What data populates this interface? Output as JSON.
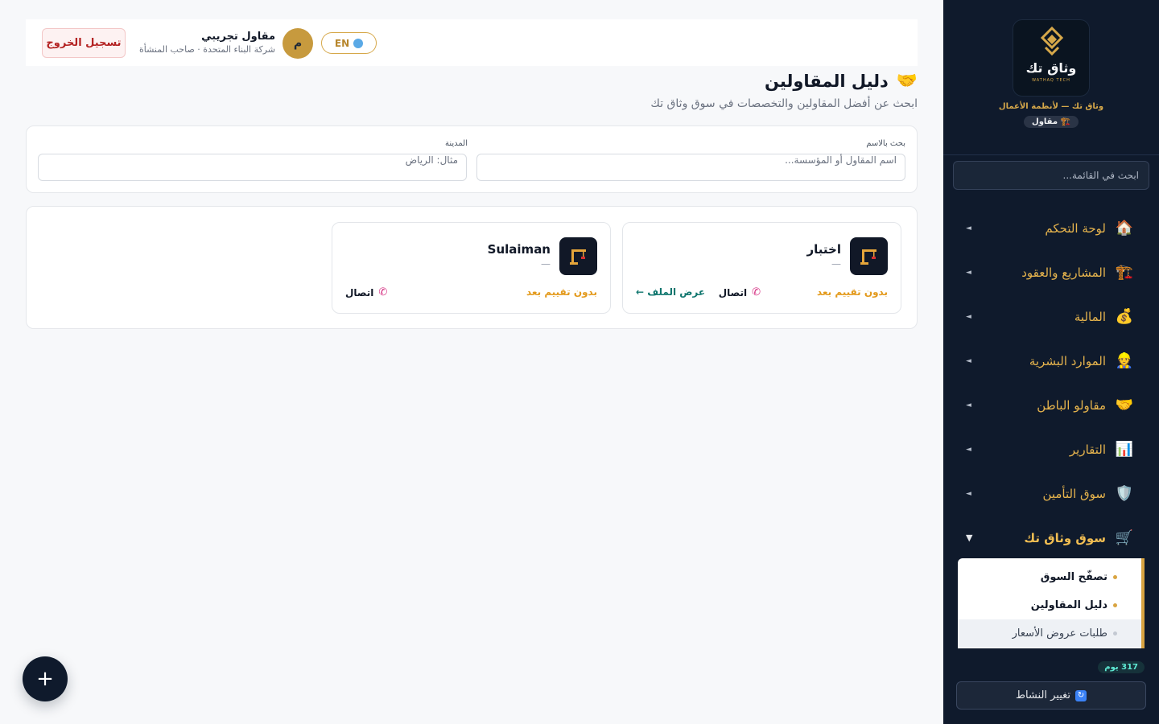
{
  "sidebar": {
    "logo_text": "وثاق تك",
    "logo_sub": "WATHAQ TECH",
    "tagline": "وثاق تك — لأنظمة الأعمال",
    "role_badge": "🏗️ مقاول",
    "search_placeholder": "ابحث في القائمة...",
    "nav": [
      {
        "label": "لوحة التحكم",
        "icon": "🏠"
      },
      {
        "label": "المشاريع والعقود",
        "icon": "🏗️"
      },
      {
        "label": "المالية",
        "icon": "💰"
      },
      {
        "label": "الموارد البشرية",
        "icon": "👷"
      },
      {
        "label": "مقاولو الباطن",
        "icon": "🤝"
      },
      {
        "label": "التقارير",
        "icon": "📊"
      },
      {
        "label": "سوق التأمين",
        "icon": "🛡️"
      },
      {
        "label": "سوق وثاق تك",
        "icon": "🛒"
      }
    ],
    "submenu": [
      {
        "label": "تصفّح السوق"
      },
      {
        "label": "دليل المقاولين"
      },
      {
        "label": "طلبات عروض الأسعار"
      }
    ],
    "days_left": "317 يوم",
    "switch_label": "تغيير النشاط"
  },
  "header": {
    "logout_label": "تسجيل الخروج",
    "user_name": "مقاول تجريبي",
    "user_org": "شركة البناء المتحدة · صاحب المنشأة",
    "avatar_letter": "م",
    "lang_label": "EN"
  },
  "page": {
    "title": "دليل المقاولين",
    "title_emoji": "🤝",
    "subtitle": "ابحث عن أفضل المقاولين والتخصصات في سوق وثاق تك"
  },
  "filters": {
    "name_label": "بحث بالاسم",
    "name_placeholder": "اسم المقاول أو المؤسسة...",
    "city_label": "المدينة",
    "city_placeholder": "مثال: الرياض"
  },
  "contractors": [
    {
      "name": "اختبار",
      "subtitle": "—",
      "rating": "بدون تقييم بعد",
      "contact": "اتصال",
      "profile": "عرض الملف ←"
    },
    {
      "name": "Sulaiman",
      "subtitle": "—",
      "rating": "بدون تقييم بعد",
      "contact": "اتصال"
    }
  ],
  "fab_label": "+",
  "colors": {
    "sidebar_bg": "#0f1a2c",
    "accent_gold": "#d6a84a",
    "rating": "#e39a1c",
    "profile_link": "#0f766e",
    "logout": "#b42323"
  }
}
